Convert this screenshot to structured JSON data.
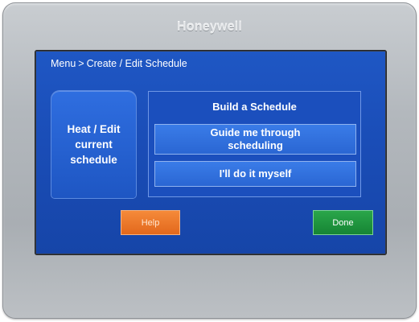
{
  "device": {
    "brand": "Honeywell"
  },
  "header": {
    "breadcrumb": [
      "Menu",
      "Create / Edit Schedule"
    ],
    "separator": ">"
  },
  "left_panel": {
    "label": "Heat / Edit current schedule"
  },
  "build_panel": {
    "title": "Build a Schedule",
    "options": [
      {
        "label": "Guide me through scheduling"
      },
      {
        "label": "I'll do it myself"
      }
    ]
  },
  "footer": {
    "help_label": "Help",
    "done_label": "Done"
  },
  "colors": {
    "screen_blue": "#1a4db7",
    "help_orange": "#e2681c",
    "done_green": "#168534"
  }
}
